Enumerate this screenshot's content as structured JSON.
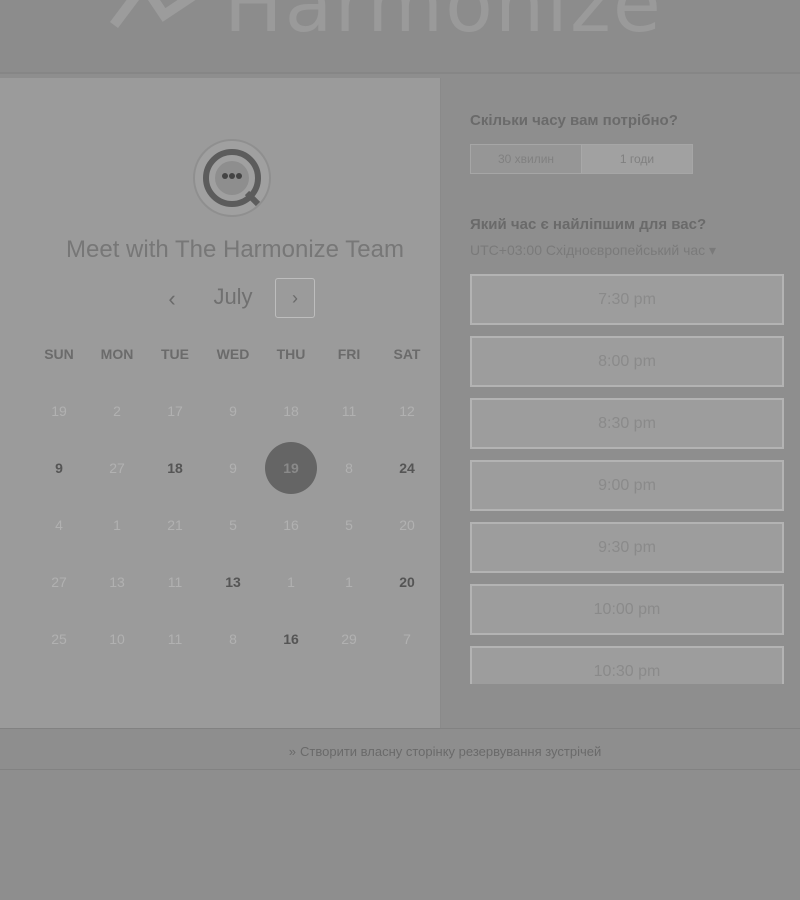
{
  "header": {
    "brand_name": "Harmonize"
  },
  "left": {
    "title": "Meet with The Harmonize Team",
    "month": "July",
    "prev_label": "‹",
    "next_label": "›",
    "weekdays": [
      "SUN",
      "MON",
      "TUE",
      "WED",
      "THU",
      "FRI",
      "SAT"
    ],
    "weeks": [
      [
        "19",
        "2",
        "17",
        "9",
        "18",
        "11",
        "12"
      ],
      [
        "9",
        "27",
        "18",
        "9",
        "19",
        "8",
        "24"
      ],
      [
        "4",
        "1",
        "21",
        "5",
        "16",
        "5",
        "20"
      ],
      [
        "27",
        "13",
        "11",
        "13",
        "1",
        "1",
        "20"
      ],
      [
        "25",
        "10",
        "11",
        "8",
        "16",
        "29",
        "7"
      ]
    ],
    "available": [
      [
        1,
        0
      ],
      [
        1,
        2
      ],
      [
        1,
        6
      ],
      [
        3,
        3
      ],
      [
        3,
        6
      ],
      [
        4,
        4
      ]
    ],
    "selected": [
      1,
      4
    ]
  },
  "right": {
    "duration_question": "Скільки часу вам потрібно?",
    "durations": [
      "30 хвилин",
      "1 годи"
    ],
    "active_duration": 0,
    "time_question": "Який час є найліпшим для вас?",
    "timezone": "UTC+03:00 Східноєвропейський час ▾",
    "slots": [
      "7:30 pm",
      "8:00 pm",
      "8:30 pm",
      "9:00 pm",
      "9:30 pm",
      "10:00 pm",
      "10:30 pm"
    ]
  },
  "footer": {
    "link_text": "Створити власну сторінку резервування зустрічей"
  },
  "colors": {
    "background": "#8e8e8e",
    "panel": "#9b9b9b",
    "selected_day": "#656565"
  }
}
